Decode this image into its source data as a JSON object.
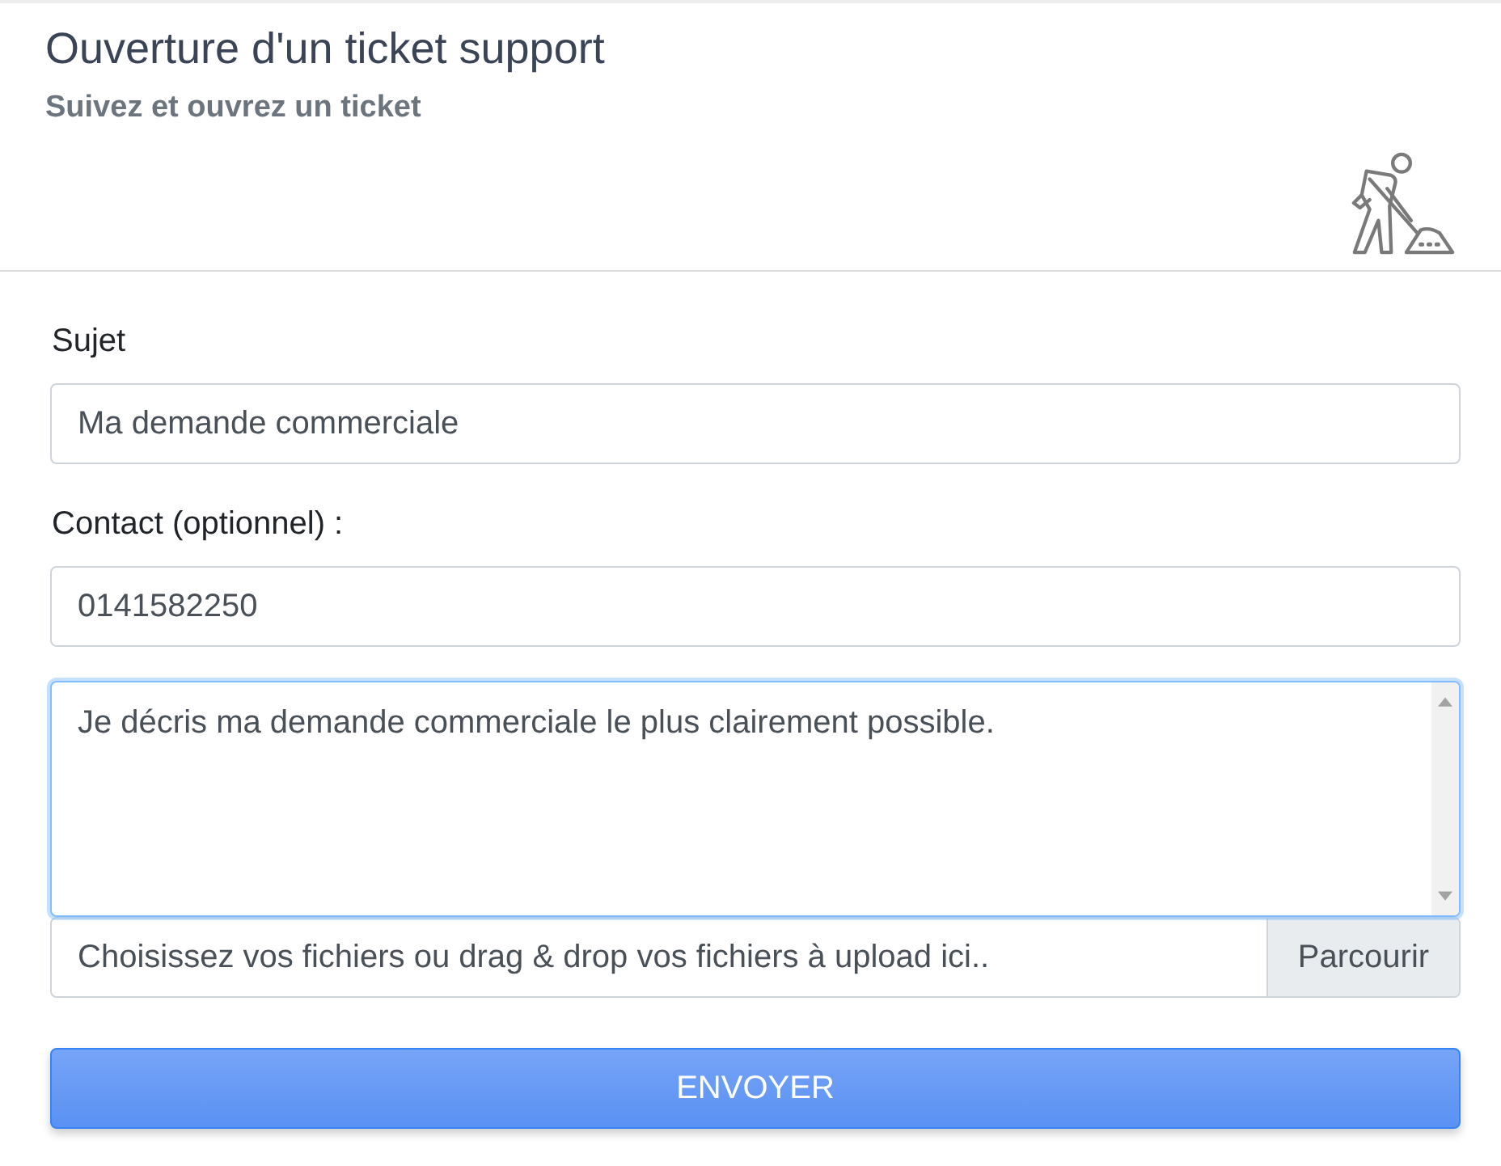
{
  "header": {
    "title": "Ouverture d'un ticket support",
    "subtitle": "Suivez et ouvrez un ticket"
  },
  "form": {
    "fields": [
      {
        "kind": "text",
        "label": "Sujet",
        "value": "Ma demande commerciale",
        "focused": false
      },
      {
        "kind": "text",
        "label": "Contact (optionnel) :",
        "value": "0141582250",
        "focused": false
      },
      {
        "kind": "textarea",
        "value": "Je décris ma demande commerciale le plus clairement possible.",
        "focused": true
      },
      {
        "kind": "file",
        "text": "Choisissez vos fichiers ou drag & drop vos fichiers à upload ici..",
        "button": "Parcourir",
        "focused": false
      }
    ],
    "submit": "ENVOYER"
  }
}
